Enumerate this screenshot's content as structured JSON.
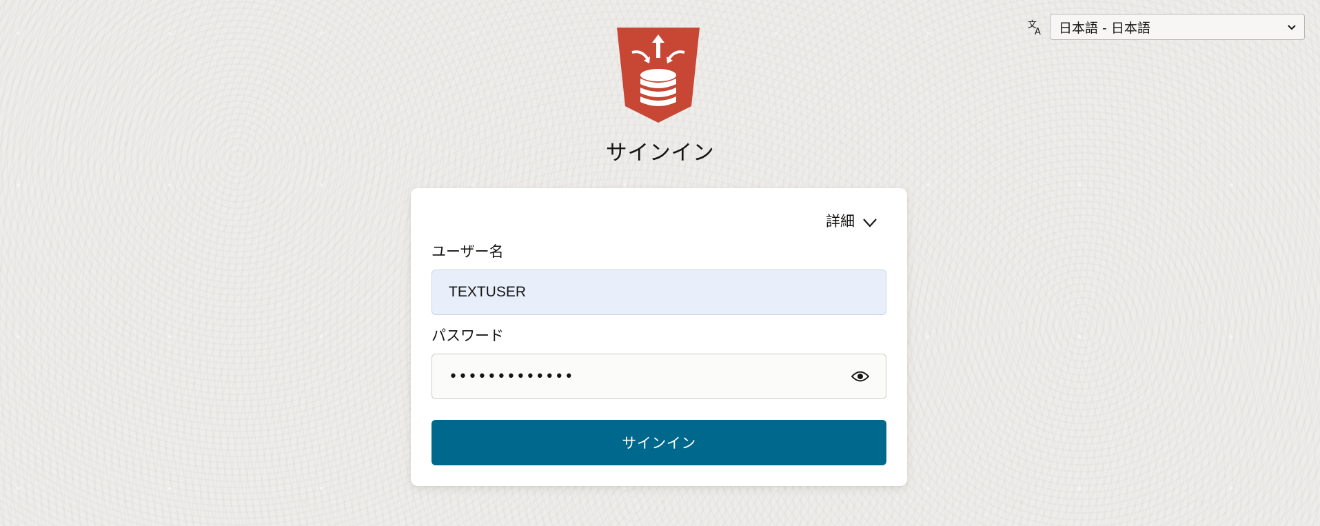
{
  "language": {
    "icon": "translate-icon",
    "selected": "日本語 - 日本語",
    "dropdown_icon": "chevron-down-icon"
  },
  "logo": {
    "icon": "database-logo-icon",
    "color": "#c74634"
  },
  "page": {
    "title": "サインイン"
  },
  "form": {
    "details_label": "詳細",
    "username_label": "ユーザー名",
    "username_value": "TEXTUSER",
    "password_label": "パスワード",
    "password_value": "•••••••••••••",
    "show_password_icon": "eye-icon",
    "submit_label": "サインイン",
    "submit_color": "#00688c"
  }
}
